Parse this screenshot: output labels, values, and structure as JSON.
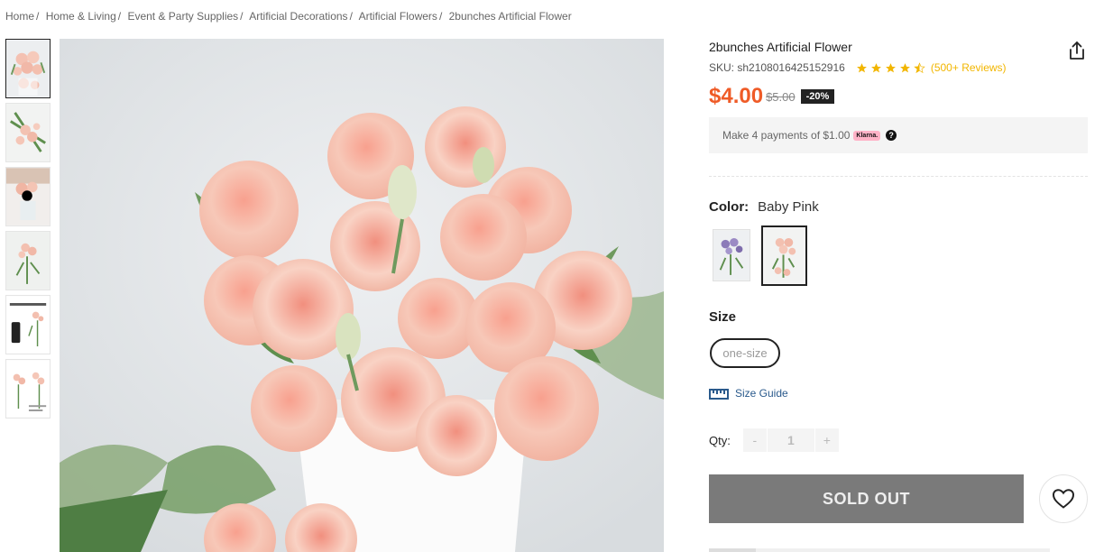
{
  "breadcrumb": {
    "items": [
      "Home",
      "Home & Living",
      "Event & Party Supplies",
      "Artificial Decorations",
      "Artificial Flowers"
    ],
    "current": "2bunches Artificial Flower",
    "separator": "/"
  },
  "product": {
    "title": "2bunches Artificial Flower",
    "sku_label": "SKU:",
    "sku": "sh2108016425152916",
    "rating_stars": 4.5,
    "reviews": "(500+ Reviews)",
    "price": "$4.00",
    "original_price": "$5.00",
    "discount": "-20%"
  },
  "klarna": {
    "text": "Make 4 payments of $1.00",
    "badge": "Klarna.",
    "help": "?"
  },
  "color": {
    "label": "Color:",
    "selected": "Baby Pink",
    "options": [
      "Purple",
      "Baby Pink"
    ]
  },
  "size": {
    "label": "Size",
    "option": "one-size",
    "guide": "Size Guide"
  },
  "qty": {
    "label": "Qty:",
    "minus": "-",
    "value": "1",
    "plus": "+"
  },
  "actions": {
    "sold_out": "SOLD OUT"
  },
  "colors": {
    "price": "#ef5b27",
    "star": "#f2b600",
    "sold_out_bg": "#7a7a7a",
    "klarna_pink": "#ffb3c7",
    "link": "#2a5a8c"
  },
  "icons": {
    "share": "share-icon",
    "wishlist": "heart-icon",
    "size_guide": "ruler-icon"
  }
}
